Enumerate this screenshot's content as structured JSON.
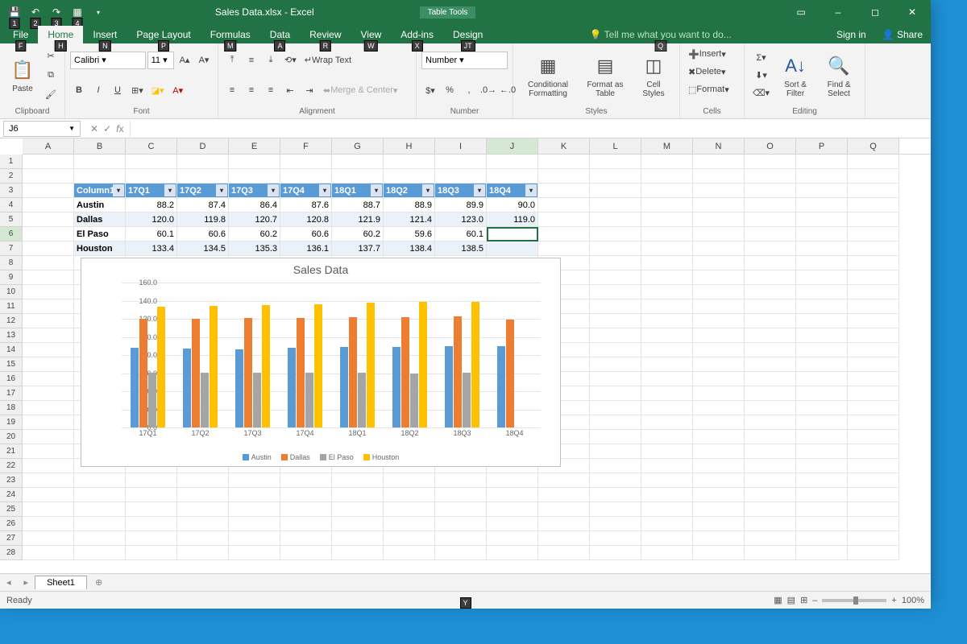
{
  "title": "Sales Data.xlsx - Excel",
  "contextual_tab_group": "Table Tools",
  "qat_keytips": [
    "1",
    "2",
    "3",
    "4"
  ],
  "ribbon_tabs": [
    {
      "label": "File",
      "kt": "F",
      "active": false
    },
    {
      "label": "Home",
      "kt": "H",
      "active": true
    },
    {
      "label": "Insert",
      "kt": "N",
      "active": false
    },
    {
      "label": "Page Layout",
      "kt": "P",
      "active": false
    },
    {
      "label": "Formulas",
      "kt": "M",
      "active": false
    },
    {
      "label": "Data",
      "kt": "A",
      "active": false
    },
    {
      "label": "Review",
      "kt": "R",
      "active": false
    },
    {
      "label": "View",
      "kt": "W",
      "active": false
    },
    {
      "label": "Add-ins",
      "kt": "X",
      "active": false
    },
    {
      "label": "Design",
      "kt": "JT",
      "active": false
    }
  ],
  "tell_me": "Tell me what you want to do...",
  "tell_me_kt": "Q",
  "sign_in": "Sign in",
  "share": "Share",
  "share_kt": "Y",
  "ribbon": {
    "clipboard_label": "Clipboard",
    "paste": "Paste",
    "font_label": "Font",
    "font_name": "Calibri",
    "font_size": "11",
    "alignment_label": "Alignment",
    "wrap": "Wrap Text",
    "merge": "Merge & Center",
    "number_label": "Number",
    "number_format": "Number",
    "styles_label": "Styles",
    "cond": "Conditional Formatting",
    "fmttbl": "Format as Table",
    "cellstyles": "Cell Styles",
    "cells_label": "Cells",
    "insert": "Insert",
    "delete": "Delete",
    "format": "Format",
    "editing_label": "Editing",
    "sort": "Sort & Filter",
    "find": "Find & Select"
  },
  "namebox": "J6",
  "formula": "",
  "columns": [
    "A",
    "B",
    "C",
    "D",
    "E",
    "F",
    "G",
    "H",
    "I",
    "J",
    "K",
    "L",
    "M",
    "N",
    "O",
    "P",
    "Q"
  ],
  "table": {
    "header_row": 3,
    "start_col": 1,
    "headers": [
      "Column1",
      "17Q1",
      "17Q2",
      "17Q3",
      "17Q4",
      "18Q1",
      "18Q2",
      "18Q3",
      "18Q4"
    ],
    "rows": [
      {
        "label": "Austin",
        "vals": [
          "88.2",
          "87.4",
          "86.4",
          "87.6",
          "88.7",
          "88.9",
          "89.9",
          "90.0"
        ]
      },
      {
        "label": "Dallas",
        "vals": [
          "120.0",
          "119.8",
          "120.7",
          "120.8",
          "121.9",
          "121.4",
          "123.0",
          "119.0"
        ]
      },
      {
        "label": "El Paso",
        "vals": [
          "60.1",
          "60.6",
          "60.2",
          "60.6",
          "60.2",
          "59.6",
          "60.1",
          ""
        ]
      },
      {
        "label": "Houston",
        "vals": [
          "133.4",
          "134.5",
          "135.3",
          "136.1",
          "137.7",
          "138.4",
          "138.5",
          ""
        ]
      }
    ]
  },
  "active_cell": {
    "row": 6,
    "col": 9
  },
  "chart_data": {
    "type": "bar",
    "title": "Sales Data",
    "categories": [
      "17Q1",
      "17Q2",
      "17Q3",
      "17Q4",
      "18Q1",
      "18Q2",
      "18Q3",
      "18Q4"
    ],
    "series": [
      {
        "name": "Austin",
        "color": "#5b9bd5",
        "values": [
          88.2,
          87.4,
          86.4,
          87.6,
          88.7,
          88.9,
          89.9,
          90.0
        ]
      },
      {
        "name": "Dallas",
        "color": "#ed7d31",
        "values": [
          120.0,
          119.8,
          120.7,
          120.8,
          121.9,
          121.4,
          123.0,
          119.0
        ]
      },
      {
        "name": "El Paso",
        "color": "#a5a5a5",
        "values": [
          60.1,
          60.6,
          60.2,
          60.6,
          60.2,
          59.6,
          60.1,
          null
        ]
      },
      {
        "name": "Houston",
        "color": "#ffc000",
        "values": [
          133.4,
          134.5,
          135.3,
          136.1,
          137.7,
          138.4,
          138.5,
          null
        ]
      }
    ],
    "ylim": [
      0,
      160
    ],
    "yticks": [
      0,
      20,
      40,
      60,
      80,
      100,
      120,
      140,
      160
    ]
  },
  "sheet_tab": "Sheet1",
  "status": "Ready",
  "zoom": "100%"
}
